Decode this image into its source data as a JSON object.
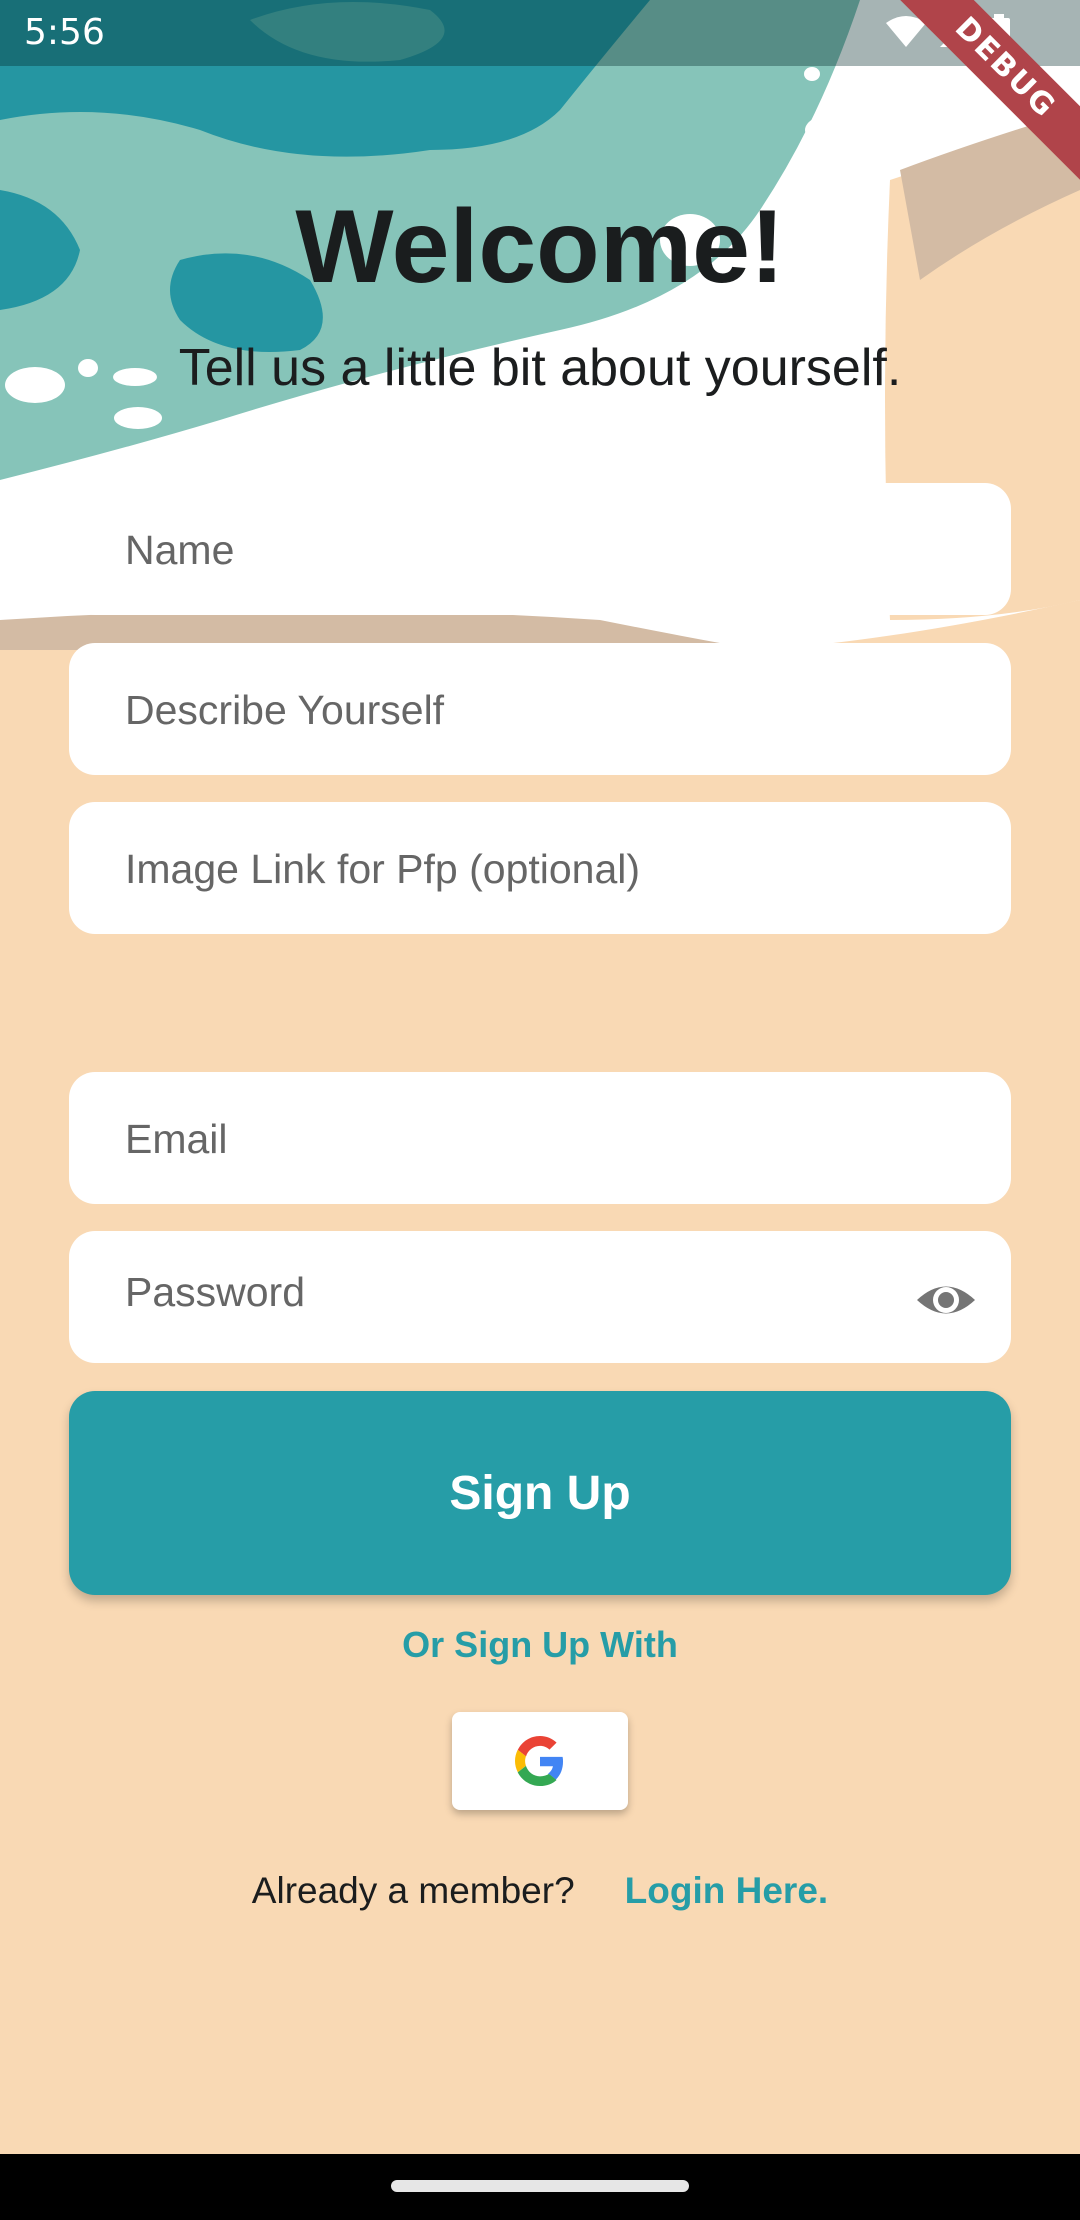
{
  "status_bar": {
    "time": "5:56",
    "debug_label": "DEBUG"
  },
  "header": {
    "title": "Welcome!",
    "subtitle": "Tell us a little bit about yourself."
  },
  "form": {
    "name_placeholder": "Name",
    "describe_placeholder": "Describe Yourself",
    "image_placeholder": "Image Link for Pfp (optional)",
    "email_placeholder": "Email",
    "password_placeholder": "Password",
    "signup_label": "Sign Up"
  },
  "social": {
    "or_label": "Or Sign Up With",
    "google_icon": "google-logo-icon"
  },
  "footer": {
    "member_text": "Already a member?",
    "login_label": "Login Here."
  },
  "colors": {
    "accent": "#269da7",
    "background": "#f9d9b4",
    "teal_dark": "#2596a2",
    "teal_light": "#86c4b9"
  }
}
